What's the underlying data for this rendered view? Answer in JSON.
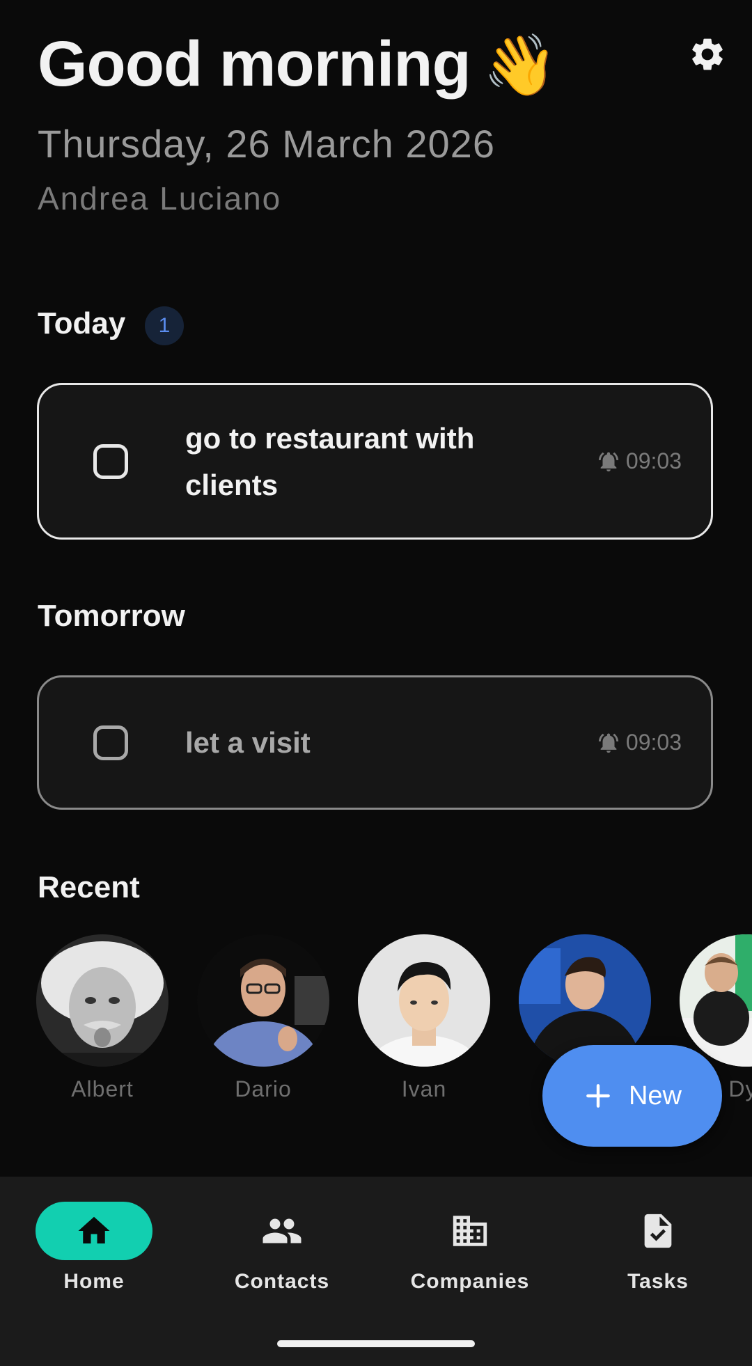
{
  "header": {
    "greeting": "Good morning",
    "greeting_emoji": "👋",
    "date": "Thursday, 26 March 2026",
    "user_name": "Andrea Luciano",
    "settings_icon": "gear-icon"
  },
  "today": {
    "title": "Today",
    "count": "1",
    "tasks": [
      {
        "title": "go to restaurant with clients",
        "time": "09:03",
        "checked": false,
        "icon": "bell-ringing-icon"
      }
    ]
  },
  "tomorrow": {
    "title": "Tomorrow",
    "tasks": [
      {
        "title": "let a visit",
        "time": "09:03",
        "checked": false,
        "icon": "bell-ringing-icon"
      }
    ]
  },
  "recent": {
    "title": "Recent",
    "contacts": [
      {
        "name": "Albert"
      },
      {
        "name": "Dario"
      },
      {
        "name": "Ivan"
      },
      {
        "name": ""
      },
      {
        "name": "Dyl"
      }
    ]
  },
  "fab": {
    "label": "New",
    "icon": "plus-icon"
  },
  "nav": {
    "items": [
      {
        "label": "Home",
        "icon": "home-icon",
        "active": true
      },
      {
        "label": "Contacts",
        "icon": "people-icon",
        "active": false
      },
      {
        "label": "Companies",
        "icon": "building-icon",
        "active": false
      },
      {
        "label": "Tasks",
        "icon": "task-check-icon",
        "active": false
      }
    ]
  },
  "colors": {
    "background": "#0a0a0a",
    "card": "#161616",
    "accent": "#4f8ef0",
    "nav_active": "#12cfb0",
    "badge_bg": "#162338",
    "badge_text": "#5b8def"
  }
}
